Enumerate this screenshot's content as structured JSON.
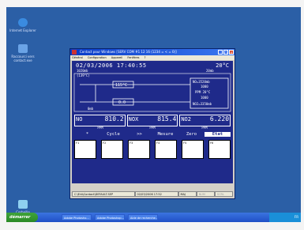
{
  "desktop": {
    "icons": [
      {
        "label": "Internet Explorer",
        "color": "#3a8be0"
      },
      {
        "label": "Raccourci vers contact.exe",
        "color": "#6aa3e6"
      },
      {
        "label": "Corbeille",
        "color": "#8fd0f0"
      }
    ]
  },
  "taskbar": {
    "start": "démarrer",
    "buttons": [
      "Adobe Photosho…",
      "Adobe Photoshop…",
      "Aide de recherche…"
    ],
    "tray": "FR"
  },
  "window": {
    "title": "Contact pour Windows [SERV COM #1 12 16 (1234 = < = 0)]",
    "menu": [
      "Général",
      "Configuration",
      "Appareil",
      "Fenêtres",
      "?"
    ],
    "datetime": "02/03/2006 17:40:55",
    "temperature": "20°C",
    "diagram": {
      "top_left": "1020mb",
      "top_left2": "(139°C)",
      "left_box": "115°C",
      "mid_box": "0.0",
      "bottom_label": "0mb",
      "right_label": "20mb",
      "no_line": "NO=3520mb",
      "val1": "1000",
      "ppm_line": "PPM 20°C",
      "val2": "1000",
      "no2_line": "NO2=3350mb"
    },
    "readings": [
      {
        "name": "NO",
        "value": "810.2",
        "unit": "PPM"
      },
      {
        "name": "NOX",
        "value": "815.4",
        "unit": "PPM"
      },
      {
        "name": "NO2",
        "value": "6.220",
        "unit": "PPM"
      }
    ],
    "menuline": [
      "*",
      "Cycle",
      ">>",
      "Mesure",
      "Zero",
      "Etat"
    ],
    "fkeys": [
      "F1",
      "F2",
      "F3",
      "F4",
      "F5",
      "F6"
    ],
    "status": {
      "path": "C:\\Erb\\Contact\\DEFAULT.SEP",
      "date": "02/03/2006 17:52",
      "mode": "MAJ",
      "n1": "NUM",
      "n2": "SCRL"
    },
    "accent": "#1f2a8a"
  }
}
